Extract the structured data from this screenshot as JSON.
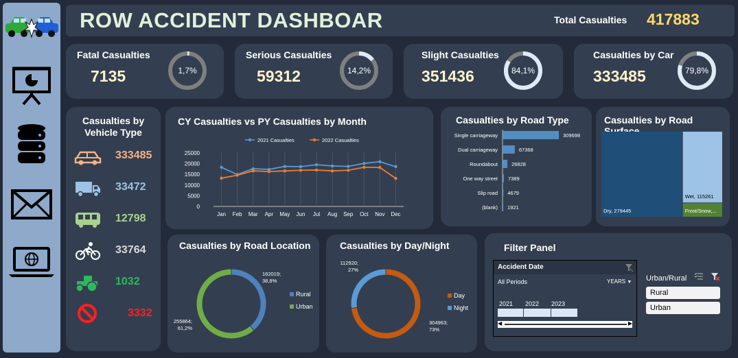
{
  "header": {
    "title": "ROW ACCIDENT DASHBOAR",
    "total_label": "Total Casualties",
    "total_value": "417883"
  },
  "kpis": [
    {
      "title": "Fatal Casualties",
      "value": "7135",
      "pct_label": "1,7%",
      "pct": 0.017
    },
    {
      "title": "Serious Casualties",
      "value": "59312",
      "pct_label": "14,2%",
      "pct": 0.142
    },
    {
      "title": "Slight Casualties",
      "value": "351436",
      "pct_label": "84,1%",
      "pct": 0.841
    },
    {
      "title": "Casualties by Car",
      "value": "333485",
      "pct_label": "79,8%",
      "pct": 0.798
    }
  ],
  "vehicle": {
    "title_line1": "Casualties by",
    "title_line2": "Vehicle Type",
    "items": [
      {
        "icon": "car-icon",
        "value": "333485",
        "color": "#f4b183"
      },
      {
        "icon": "truck-icon",
        "value": "33472",
        "color": "#9dc3e6"
      },
      {
        "icon": "bus-icon",
        "value": "12798",
        "color": "#a9d18e"
      },
      {
        "icon": "bicycle-icon",
        "value": "33764",
        "color": "#d9d9d9"
      },
      {
        "icon": "tractor-icon",
        "value": "1032",
        "color": "#2eb85c"
      },
      {
        "icon": "prohibited-icon",
        "value": "3332",
        "color": "#ff2020"
      }
    ]
  },
  "chart_data": [
    {
      "type": "line",
      "title": "CY Casualties vs PY Casualties by Month",
      "categories": [
        "Jan",
        "Feb",
        "Mar",
        "Apr",
        "May",
        "Jun",
        "Jul",
        "Aug",
        "Sep",
        "Oct",
        "Nov",
        "Dec"
      ],
      "y_ticks": [
        "0",
        "2500",
        "5000",
        "7500",
        "10000",
        "12500",
        "15000",
        "17500",
        "20000",
        "22500",
        "25000"
      ],
      "ylim": [
        0,
        25000
      ],
      "series": [
        {
          "name": "2021 Casualties",
          "color": "#5b9bd5",
          "values": [
            18300,
            14900,
            17600,
            17300,
            18700,
            18600,
            19500,
            18900,
            18700,
            20100,
            20900,
            18600
          ]
        },
        {
          "name": "2022 Casualties",
          "color": "#ed7d31",
          "values": [
            13200,
            14600,
            16600,
            16300,
            16600,
            16900,
            17000,
            16600,
            16900,
            18300,
            18200,
            13100
          ]
        }
      ]
    },
    {
      "type": "bar",
      "title": "Casualties by Road Type",
      "categories": [
        "Single carriageway",
        "Dual carriageway",
        "Roundabout",
        "One way street",
        "Slip road",
        "(blank)"
      ],
      "values": [
        309698,
        67368,
        26828,
        7389,
        4679,
        1921
      ],
      "labels": [
        "309698",
        "67368",
        "26828",
        "7389",
        "4679",
        "1921"
      ]
    },
    {
      "type": "heatmap",
      "title": "Casualties by Road Surface",
      "items": [
        {
          "label": "Dry, 279445",
          "value": 279445,
          "color": "#1f4e79"
        },
        {
          "label": "Wet, 115261",
          "value": 115261,
          "color": "#9dc3e6"
        },
        {
          "label": "Frost/Snow,...",
          "value": 23177,
          "color": "#548235"
        }
      ]
    },
    {
      "type": "pie",
      "title": "Casualties by Road Location",
      "items": [
        {
          "name": "Rural",
          "value": 162019,
          "label1": "162019;",
          "label2": "38,8%",
          "color": "#4f81bd"
        },
        {
          "name": "Urban",
          "value": 255864,
          "label1": "255864;",
          "label2": "61,2%",
          "color": "#70ad47"
        }
      ]
    },
    {
      "type": "pie",
      "title": "Casualties by Day/Night",
      "items": [
        {
          "name": "Day",
          "value": 304963,
          "label1": "304963;",
          "label2": "73%",
          "color": "#c55a11"
        },
        {
          "name": "Night",
          "value": 112920,
          "label1": "112920;",
          "label2": "27%",
          "color": "#5b9bd5"
        }
      ]
    }
  ],
  "filter": {
    "title": "Filter Panel",
    "date_header": "Accident Date",
    "period_label": "All Periods",
    "years_label": "YEARS",
    "years": [
      "2021",
      "2022",
      "2023"
    ],
    "urban_header": "Urban/Rural",
    "options": [
      "Rural",
      "Urban"
    ]
  }
}
